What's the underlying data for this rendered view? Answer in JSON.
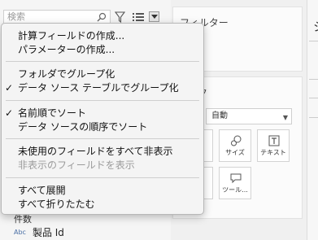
{
  "search": {
    "placeholder": "検索"
  },
  "fields": {
    "partial_label": "件数",
    "product_id": {
      "type_badge": "Abc",
      "label": "製品 Id"
    }
  },
  "filters_card": {
    "title": "フィルター"
  },
  "marks_card": {
    "partial_title": "ク",
    "mark_type": "自動",
    "buttons": [
      {
        "label": "サイズ",
        "icon": "size-icon"
      },
      {
        "label": "テキスト",
        "icon": "text-icon"
      },
      {
        "label": "ツール...",
        "icon": "tooltip-icon"
      }
    ]
  },
  "right_edge": {
    "partial_label": "シ"
  },
  "context_menu": {
    "items": [
      {
        "label": "計算フィールドの作成...",
        "checked": false,
        "enabled": true
      },
      {
        "label": "パラメーターの作成...",
        "checked": false,
        "enabled": true
      },
      {
        "label": "フォルダでグループ化",
        "checked": false,
        "enabled": true
      },
      {
        "label": "データ ソース テーブルでグループ化",
        "checked": true,
        "enabled": true
      },
      {
        "label": "名前順でソート",
        "checked": true,
        "enabled": true
      },
      {
        "label": "データ ソースの順序でソート",
        "checked": false,
        "enabled": true
      },
      {
        "label": "未使用のフィールドをすべて非表示",
        "checked": false,
        "enabled": true
      },
      {
        "label": "非表示のフィールドを表示",
        "checked": false,
        "enabled": false
      },
      {
        "label": "すべて展開",
        "checked": false,
        "enabled": true
      },
      {
        "label": "すべて折りたたむ",
        "checked": false,
        "enabled": true
      }
    ],
    "check_glyph": "✓"
  }
}
